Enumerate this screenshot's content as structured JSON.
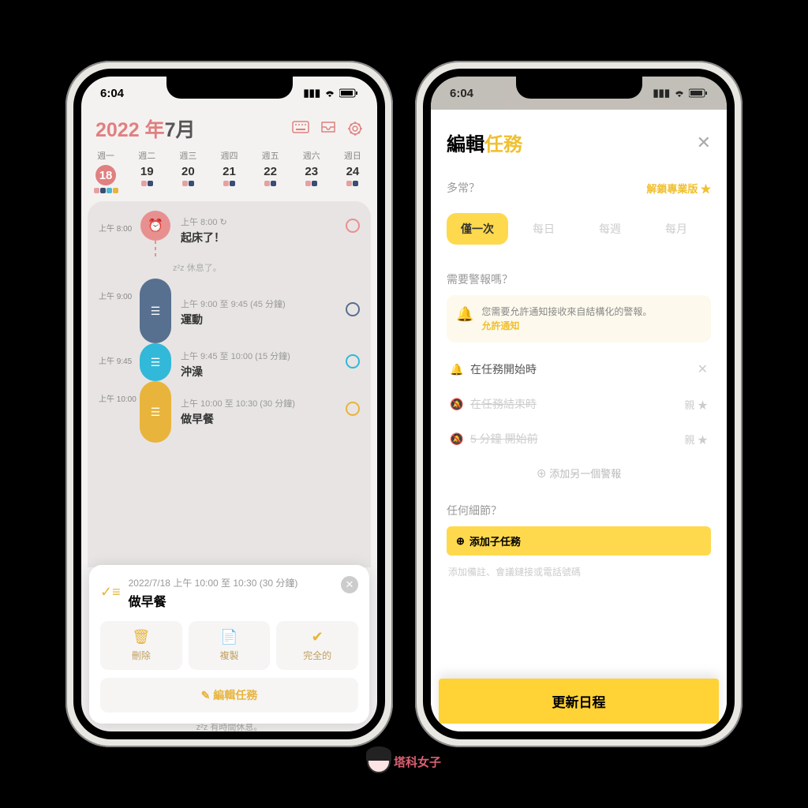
{
  "status": {
    "time": "6:04"
  },
  "left": {
    "title_year": "2022 年",
    "title_month": "7月",
    "week_labels": [
      "週一",
      "週二",
      "週三",
      "週四",
      "週五",
      "週六",
      "週日"
    ],
    "week_days": [
      "18",
      "19",
      "20",
      "21",
      "22",
      "23",
      "24"
    ],
    "timeline": {
      "t1": {
        "time_gutter": "上午 8:00",
        "meta": "上午 8:00 ↻",
        "title": "起床了！"
      },
      "rest1": "z²z  休息了。",
      "t2": {
        "time_gutter": "上午 9:00",
        "meta": "上午 9:00 至 9:45 (45 分鐘)",
        "title": "運動"
      },
      "t3": {
        "time_gutter": "上午 9:45",
        "meta": "上午 9:45 至 10:00 (15 分鐘)",
        "title": "沖澡"
      },
      "t4": {
        "time_gutter": "上午 10:00",
        "meta": "上午 10:00 至 10:30 (30 分鐘)",
        "title": "做早餐"
      },
      "rest2": "z²z  有時間休息。"
    },
    "popup": {
      "meta": "2022/7/18 上午 10:00 至 10:30 (30 分鐘)",
      "title": "做早餐",
      "delete": "刪除",
      "copy": "複製",
      "complete": "完全的",
      "edit": "✎  編輯任務"
    }
  },
  "right": {
    "sheet_title_a": "編輯",
    "sheet_title_b": "任務",
    "freq_label": "多常？",
    "unlock": "解鎖專業版 ★",
    "freq_tabs": {
      "once": "僅一次",
      "daily": "每日",
      "weekly": "每週",
      "monthly": "每月"
    },
    "alarm_label": "需要警報嗎？",
    "banner_text": "您需要允許通知接收來自結構化的警報。",
    "banner_allow": "允許通知",
    "alarm1": "在任務開始時",
    "alarm2": "在任務結束時",
    "alarm2_tail": "親 ★",
    "alarm3": "5 分鐘 開始前",
    "alarm3_tail": "親 ★",
    "add_alarm": "⊕ 添加另一個警報",
    "details_label": "任何細節？",
    "add_subtask": "添加子任務",
    "note_placeholder": "添加備註、會議鏈接或電話號碼",
    "update": "更新日程"
  },
  "brand": "塔科女子"
}
